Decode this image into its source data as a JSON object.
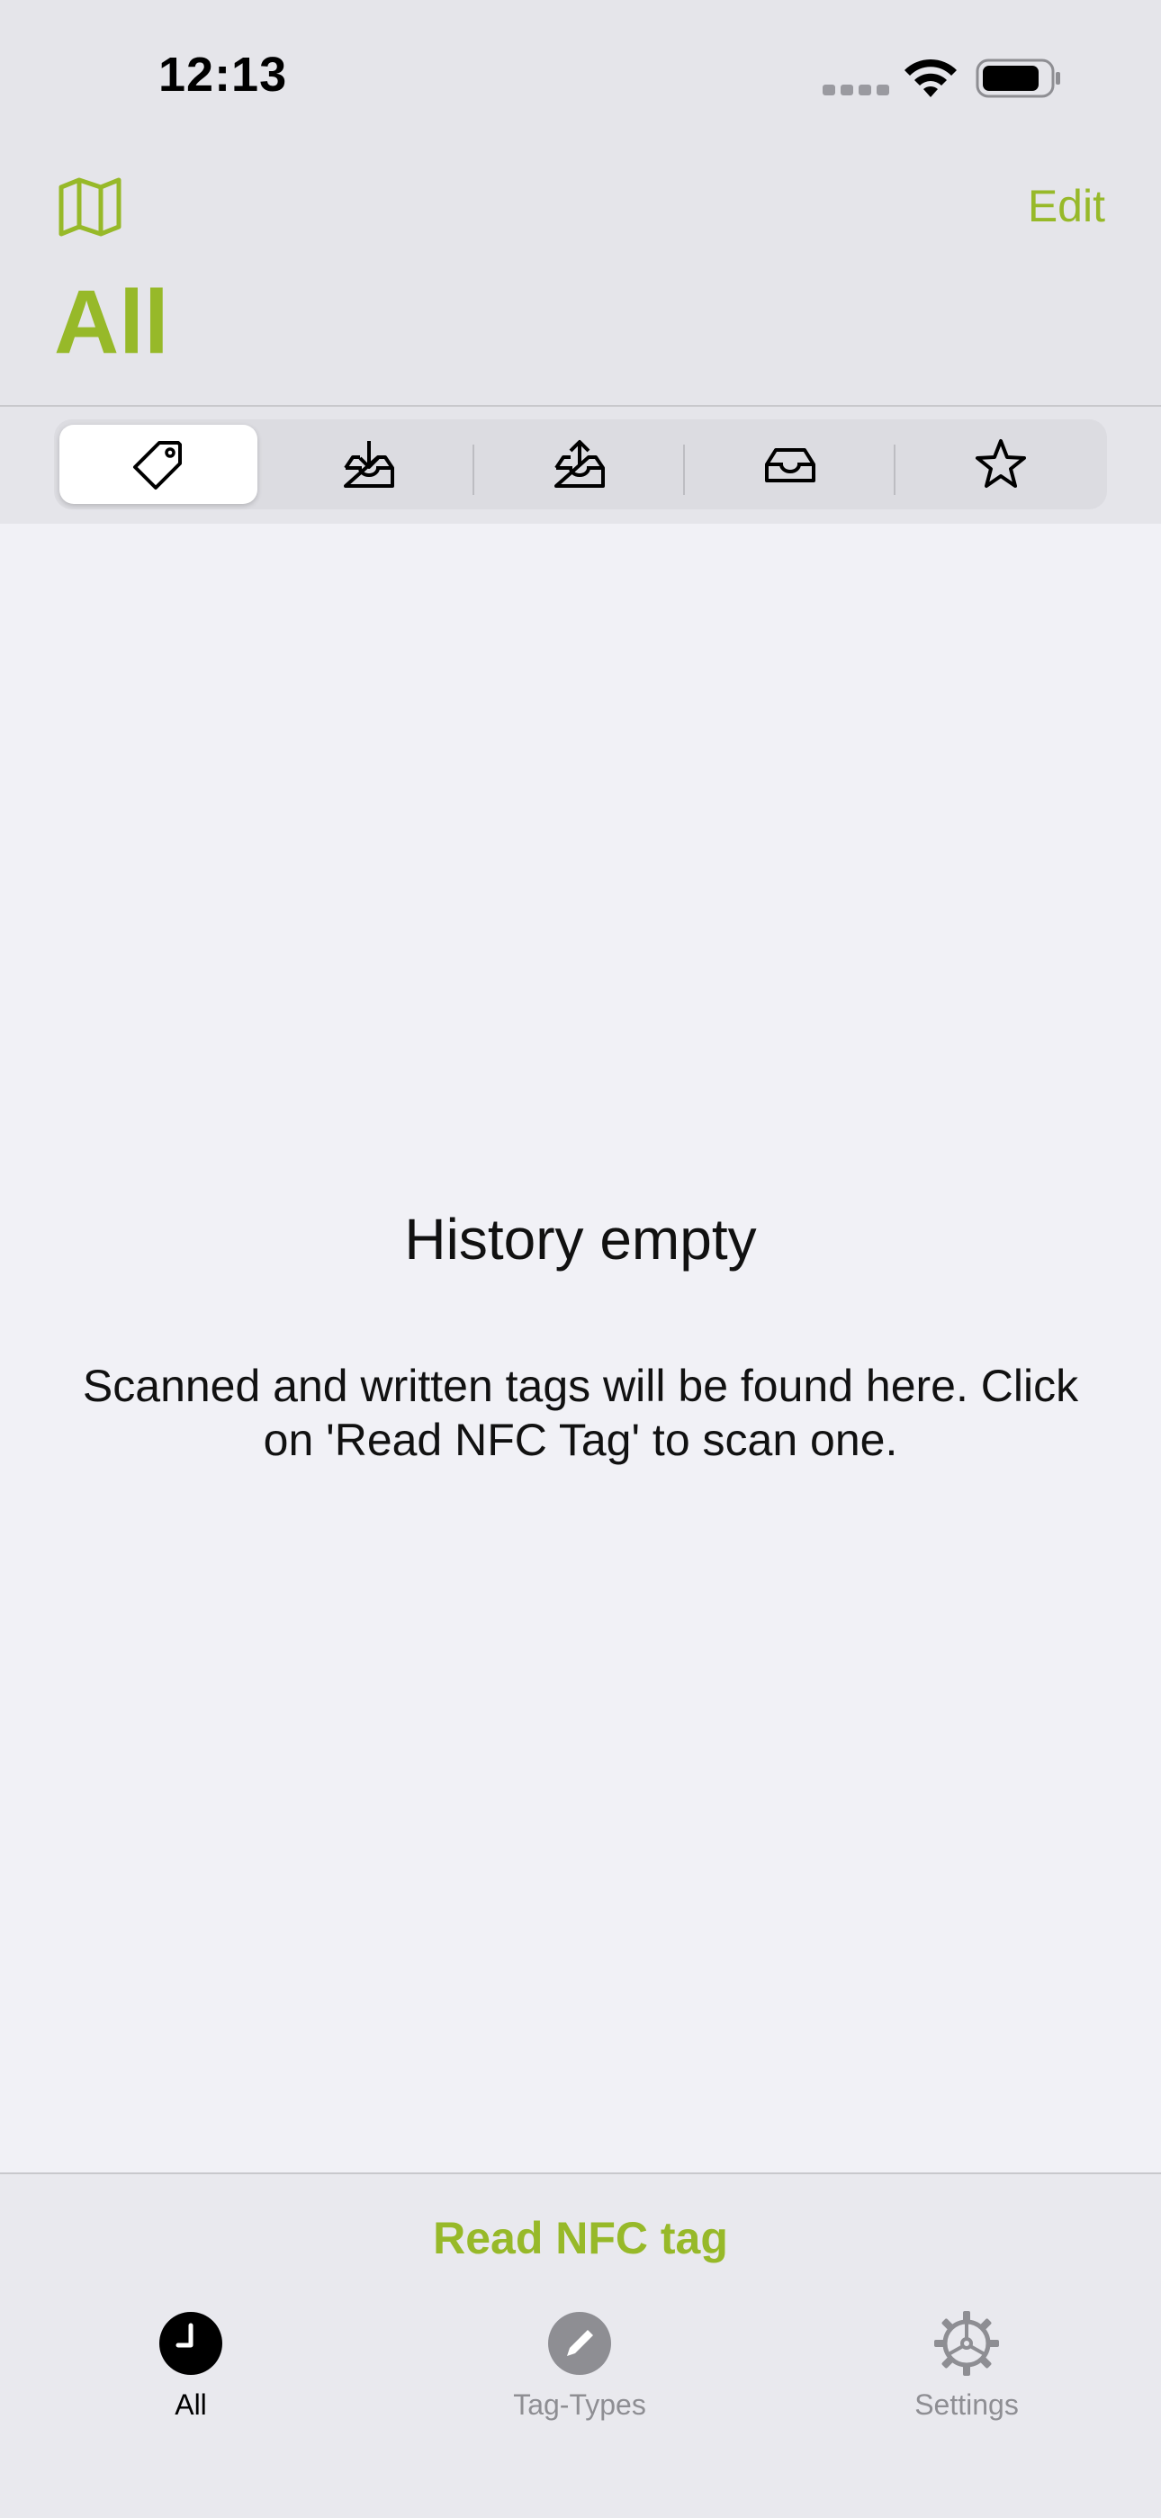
{
  "status_bar": {
    "time": "12:13"
  },
  "nav": {
    "title": "All",
    "edit_label": "Edit"
  },
  "segments": [
    {
      "icon": "tag-icon",
      "selected": true
    },
    {
      "icon": "tray-download-icon",
      "selected": false
    },
    {
      "icon": "tray-upload-icon",
      "selected": false
    },
    {
      "icon": "tray-icon",
      "selected": false
    },
    {
      "icon": "star-icon",
      "selected": false
    }
  ],
  "empty_state": {
    "title": "History empty",
    "message": "Scanned and written tags will be found here. Click on 'Read NFC Tag' to scan one."
  },
  "bottom": {
    "read_button": "Read NFC tag"
  },
  "tabs": [
    {
      "label": "All",
      "icon": "clock-icon",
      "active": true
    },
    {
      "label": "Tag-Types",
      "icon": "pencil-icon",
      "active": false
    },
    {
      "label": "Settings",
      "icon": "gear-icon",
      "active": false
    }
  ],
  "colors": {
    "accent": "#97b929",
    "inactive": "#8e8e93"
  }
}
